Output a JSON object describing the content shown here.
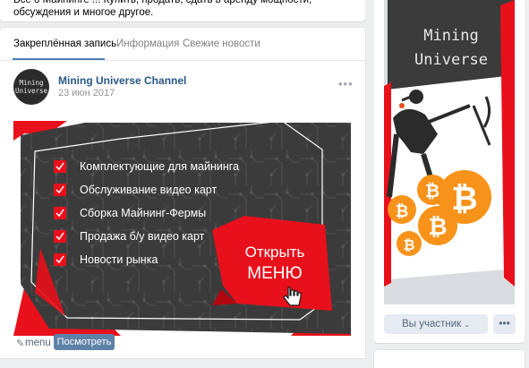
{
  "group": {
    "description": "Всё о Майнинге !!! Купить, продать, сдать в аренду мощности, обсуждения и многое другое."
  },
  "tabs": [
    {
      "label": "Закреплённая запись",
      "active": true
    },
    {
      "label": "Информация",
      "active": false
    },
    {
      "label": "Свежие новости",
      "active": false
    }
  ],
  "post": {
    "avatar_text": [
      "Mining",
      "Universe"
    ],
    "author": "Mining Universe Channel",
    "date": "23 июн 2017",
    "more": "•••",
    "banner": {
      "menu_items": [
        "Комплектующие для майнинга",
        "Обслуживание видео карт",
        "Сборка Майнинг-Фермы",
        "Продажа б/у видео карт",
        "Новости рынка"
      ],
      "cta_line1": "Открыть",
      "cta_line2": "МЕНЮ"
    },
    "attachment_label": "menu",
    "view_button": "Посмотреть"
  },
  "cover": {
    "title_line1": "Mining",
    "title_line2": "Universe"
  },
  "membership": {
    "status_label": "Вы участник",
    "actions": "•••"
  },
  "colors": {
    "accent_red": "#e8101b",
    "banner_dark": "#3b3b3b",
    "link": "#2a5885",
    "button": "#5e81a8",
    "bitcoin": "#f7931a"
  }
}
